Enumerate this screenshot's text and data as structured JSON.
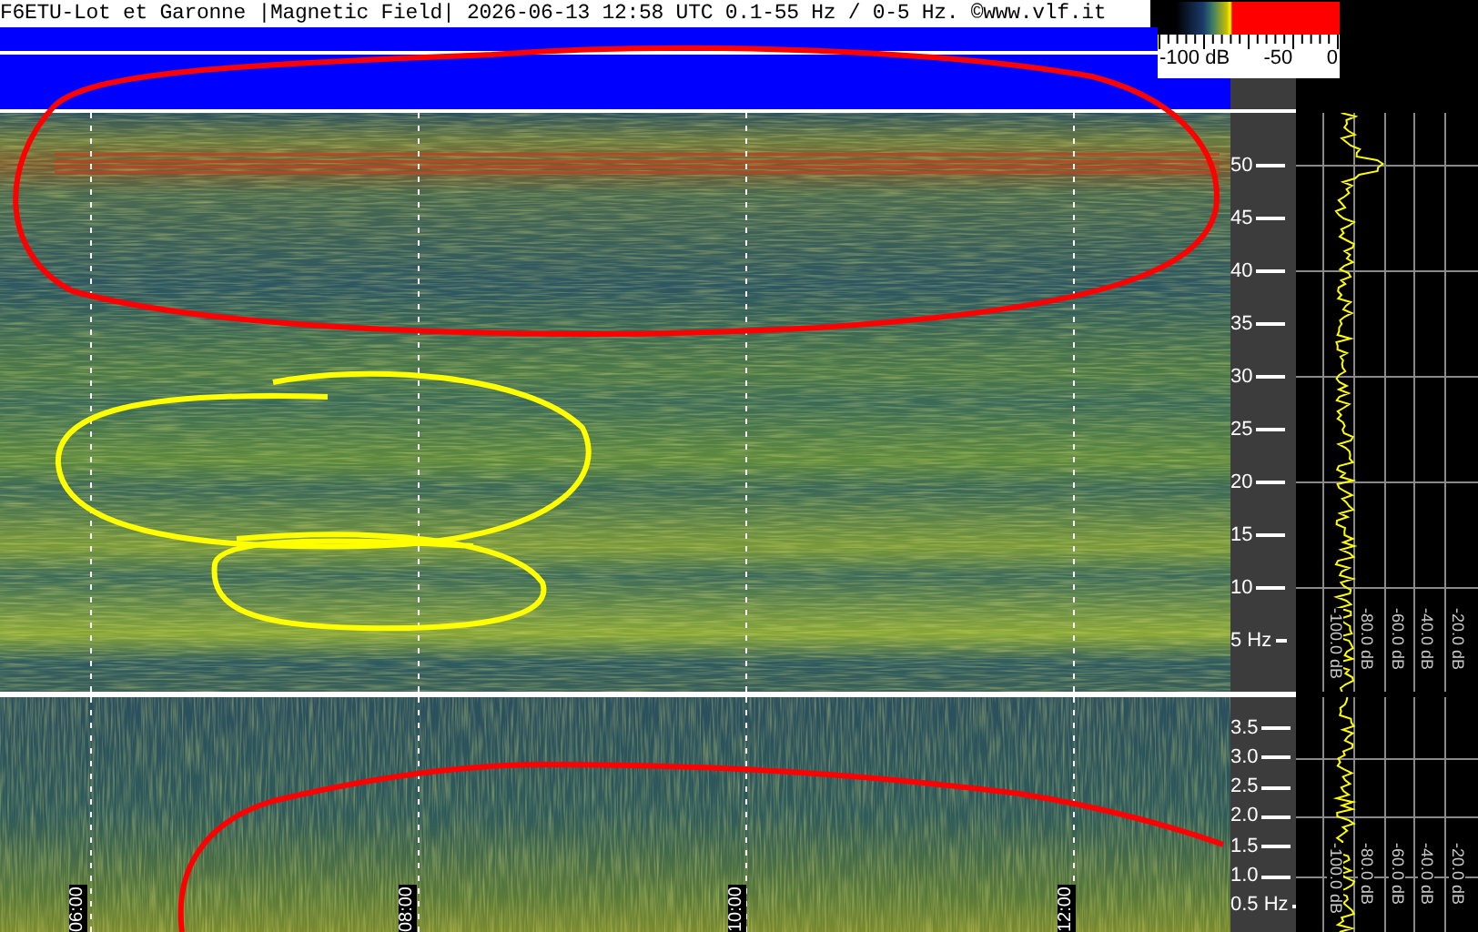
{
  "header": {
    "title": "F6ETU-Lot et Garonne |Magnetic Field| 2026-06-13 12:58 UTC 0.1-55 Hz / 0-5 Hz. ©www.vlf.it"
  },
  "color_scale": {
    "labels": [
      "-100 dB",
      "-50",
      "0"
    ]
  },
  "upper_panel": {
    "frequency_labels": [
      "50",
      "45",
      "40",
      "35",
      "30",
      "25",
      "20",
      "15",
      "10",
      "5 Hz"
    ],
    "db_labels": [
      "-100.0 dB",
      "-80.0 dB",
      "-60.0 dB",
      "-40.0 dB",
      "-20.0 dB"
    ]
  },
  "lower_panel": {
    "frequency_labels": [
      "3.5",
      "3.0",
      "2.5",
      "2.0",
      "1.5",
      "1.0",
      "0.5 Hz"
    ],
    "db_labels": [
      "-100.0 dB",
      "-80.0 dB",
      "-60.0 dB",
      "-40.0 dB",
      "-20.0 dB"
    ]
  },
  "time_labels": [
    "06:00",
    "08:00",
    "10:00",
    "12:00"
  ]
}
